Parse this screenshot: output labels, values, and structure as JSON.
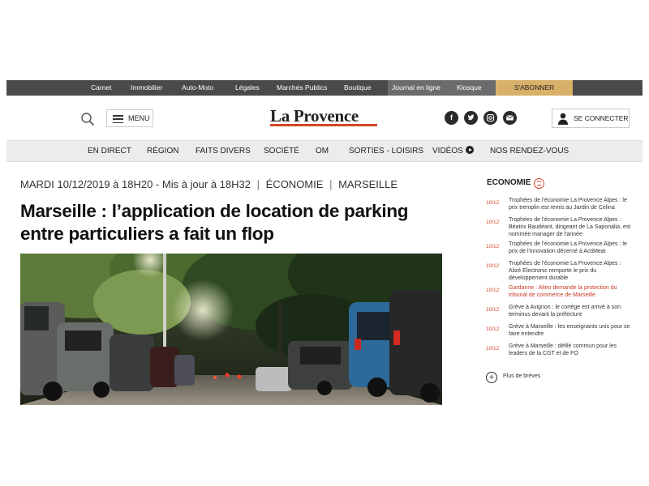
{
  "topbar": {
    "links": [
      "Carnet",
      "Immobilier",
      "Auto-Moto",
      "Légales",
      "Marchés Publics",
      "Boutique",
      "Journal en ligne",
      "Kiosque"
    ],
    "subscribe": "S'ABONNER"
  },
  "header": {
    "menu_label": "MENU",
    "logo": "La Provence",
    "connect_label": "SE CONNECTER",
    "social": [
      "facebook-icon",
      "twitter-icon",
      "instagram-icon",
      "email-icon"
    ]
  },
  "nav": {
    "items": [
      "EN DIRECT",
      "RÉGION",
      "FAITS DIVERS",
      "SOCIÉTÉ",
      "OM",
      "SORTIES - LOISIRS",
      "VIDÉOS",
      "NOS RENDEZ-VOUS"
    ]
  },
  "article": {
    "date": "MARDI 10/12/2019 à 18H20 - Mis à jour à 18H32",
    "section": "ÉCONOMIE",
    "city": "MARSEILLE",
    "sep": "|",
    "title": "Marseille : l’application de location de parking entre particuliers a fait un flop"
  },
  "sidebar": {
    "title": "ECONOMIE",
    "briefs": [
      {
        "date": "10/12",
        "title": "Trophées de l'économie La Provence Alpes : le prix tremplin est remis au Jardin de Celina"
      },
      {
        "date": "10/12",
        "title": "Trophées de l'économie La Provence Alpes : Béatrix Baudéant, dirigeant de La Saponalia, est nommée manager de l'année"
      },
      {
        "date": "10/12",
        "title": "Trophées de l'économie La Provence Alpes : le prix de l'innovation décerné à ActiMeat"
      },
      {
        "date": "10/12",
        "title": "Trophées de l'économie La Provence Alpes : Alizé Electronic remporte le prix du développement durable"
      },
      {
        "date": "10/12",
        "title": "Gardanne : Alteo demande la protection du tribunal de commerce de Marseille"
      },
      {
        "date": "10/12",
        "title": "Grève à Avignon : le cortège est arrivé à son terminus devant la préfecture"
      },
      {
        "date": "10/12",
        "title": "Grève à Marseille : les enseignants unis pour se faire entendre"
      },
      {
        "date": "10/12",
        "title": "Grève à Marseille : défilé commun pour les leaders de la CGT et de FO"
      }
    ],
    "more": "Plus de brèves"
  },
  "colors": {
    "accent_red": "#d9432b",
    "subscribe_gold": "#d9b06a",
    "topbar_dark": "#4a4a4a"
  }
}
